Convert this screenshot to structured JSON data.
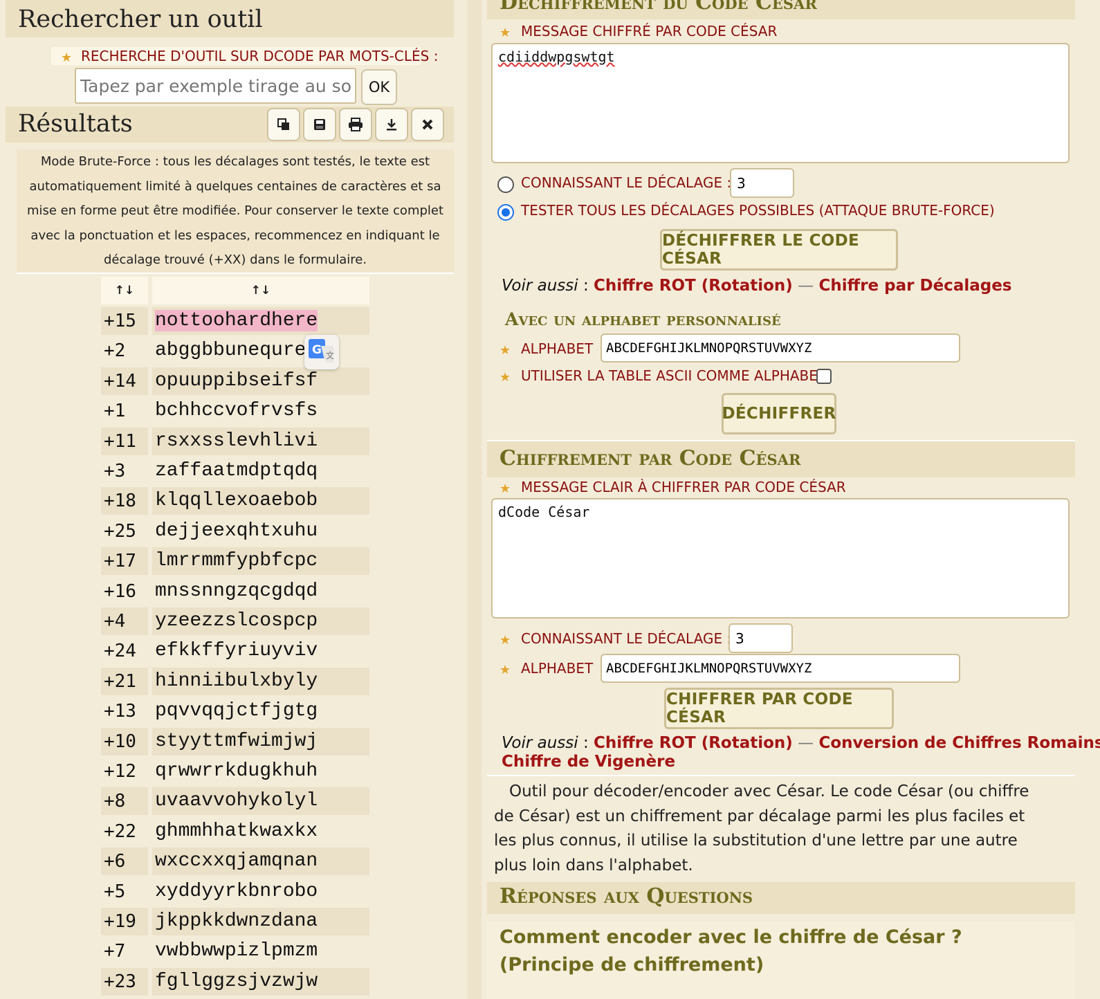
{
  "search": {
    "title": "Rechercher un outil",
    "label": "RECHERCHE D'OUTIL SUR DCODE PAR MOTS-CLÉS :",
    "placeholder": "Tapez par exemple tirage au sort",
    "ok_label": "OK"
  },
  "results": {
    "title": "Résultats",
    "toolbar": [
      "copy-icon",
      "save-icon",
      "print-icon",
      "download-icon",
      "close-icon"
    ],
    "note": "Mode Brute-Force : tous les décalages sont testés, le texte est automatiquement limité à quelques centaines de caractères et sa mise en forme peut être modifiée. Pour conserver le texte complet avec la ponctuation et les espaces, recommencez en indiquant le décalage trouvé (+XX) dans le formulaire.",
    "sort_header_1": "↑↓",
    "sort_header_2": "↑↓",
    "rows": [
      {
        "shift": "+15",
        "text": "nottoohardhere"
      },
      {
        "shift": "+2",
        "text": "abggbbunequre"
      },
      {
        "shift": "+14",
        "text": "opuuppibseifsf"
      },
      {
        "shift": "+1",
        "text": "bchhccvofrvsfs"
      },
      {
        "shift": "+11",
        "text": "rsxxsslevhlivi"
      },
      {
        "shift": "+3",
        "text": "zaffaatmdptqdq"
      },
      {
        "shift": "+18",
        "text": "klqqllexoaebob"
      },
      {
        "shift": "+25",
        "text": "dejjeexqhtxuhu"
      },
      {
        "shift": "+17",
        "text": "lmrrmmfypbfcpc"
      },
      {
        "shift": "+16",
        "text": "mnssnngzqcgdqd"
      },
      {
        "shift": "+4",
        "text": "yzeezzslcospcp"
      },
      {
        "shift": "+24",
        "text": "efkkffyriuyviv"
      },
      {
        "shift": "+21",
        "text": "hinniibulxbyly"
      },
      {
        "shift": "+13",
        "text": "pqvvqqjctfjgtg"
      },
      {
        "shift": "+10",
        "text": "styyttmfwimjwj"
      },
      {
        "shift": "+12",
        "text": "qrwwrrkdugkhuh"
      },
      {
        "shift": "+8",
        "text": "uvaavvohykolyl"
      },
      {
        "shift": "+22",
        "text": "ghmmhhatkwaxkx"
      },
      {
        "shift": "+6",
        "text": "wxccxxqjamqnan"
      },
      {
        "shift": "+5",
        "text": "xyddyyrkbnrobo"
      },
      {
        "shift": "+19",
        "text": "jkppkkdwnzdana"
      },
      {
        "shift": "+7",
        "text": "vwbbwwpizlpmzm"
      },
      {
        "shift": "+23",
        "text": "fgllggzsjvzwjw"
      }
    ]
  },
  "decrypt": {
    "title": "Déchiffrement du Code César",
    "message_label": "MESSAGE CHIFFRÉ PAR CODE CÉSAR",
    "message_value": "cdiiddwpgswtgt",
    "known_shift_label": "CONNAISSANT LE DÉCALAGE :",
    "known_shift_value": "3",
    "brute_force_label": "TESTER TOUS LES DÉCALAGES POSSIBLES (ATTAQUE BRUTE-FORCE)",
    "button_label": "DÉCHIFFRER LE CODE CÉSAR",
    "see_also_prefix": "Voir aussi",
    "see_also_links": [
      "Chiffre ROT (Rotation)",
      "Chiffre par Décalages"
    ],
    "alphabet_section_title": "Avec un alphabet personnalisé",
    "alphabet_label": "ALPHABET",
    "alphabet_value": "ABCDEFGHIJKLMNOPQRSTUVWXYZ",
    "ascii_label": "UTILISER LA TABLE ASCII COMME ALPHABET",
    "decipher_button": "DÉCHIFFRER"
  },
  "encrypt": {
    "title": "Chiffrement par Code César",
    "message_label": "MESSAGE CLAIR À CHIFFRER PAR CODE CÉSAR",
    "message_value": "dCode César",
    "shift_label": "CONNAISSANT LE DÉCALAGE :",
    "shift_value": "3",
    "alphabet_label": "ALPHABET",
    "alphabet_value": "ABCDEFGHIJKLMNOPQRSTUVWXYZ",
    "button_label": "CHIFFRER PAR CODE CÉSAR",
    "see_also_prefix": "Voir aussi",
    "see_also_links": [
      "Chiffre ROT (Rotation)",
      "Conversion de Chiffres Romains",
      "Chiffre de Vigenère"
    ]
  },
  "description": "Outil pour décoder/encoder avec César. Le code César (ou chiffre de César) est un chiffrement par décalage parmi les plus faciles et les plus connus, il utilise la substitution d'une lettre par une autre plus loin dans l'alphabet.",
  "faq": {
    "title": "Réponses aux Questions",
    "question": "Comment encoder avec le chiffre de César ? (Principe de chiffrement)"
  },
  "colors": {
    "background": "#f3ecd9",
    "accent_red": "#a31515",
    "title_olive": "#6e6a1e",
    "highlight_pink": "#f3b6c9"
  }
}
